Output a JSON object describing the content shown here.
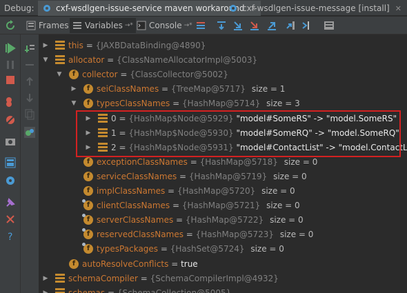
{
  "header": {
    "debug_label": "Debug:",
    "tabs": [
      {
        "label": "cxf-wsdlgen-issue-service maven workaround",
        "active": true
      },
      {
        "label": "cxf-wsdlgen-issue-message [install]",
        "active": false
      }
    ]
  },
  "toolbar": {
    "tabs": [
      {
        "label": "Frames"
      },
      {
        "label": "Variables"
      },
      {
        "label": "Console"
      }
    ]
  },
  "tree": [
    {
      "name": "this",
      "eq": " = ",
      "value": "{JAXBDataBinding@4890}",
      "extra": "",
      "sz": "",
      "indent": 0,
      "expand": "collapsed",
      "icon": "list"
    },
    {
      "name": "allocator",
      "eq": " = ",
      "value": "{ClassNameAllocatorImpl@5003}",
      "extra": "",
      "sz": "",
      "indent": 0,
      "expand": "expanded",
      "icon": "list"
    },
    {
      "name": "collector",
      "eq": " = ",
      "value": "{ClassCollector@5002}",
      "extra": "",
      "sz": "",
      "indent": 1,
      "expand": "expanded",
      "icon": "f"
    },
    {
      "name": "seiClassNames",
      "eq": " = ",
      "value": "{TreeMap@5717}",
      "extra": "",
      "sz": "size = 1",
      "indent": 2,
      "expand": "collapsed",
      "icon": "f"
    },
    {
      "name": "typesClassNames",
      "eq": " = ",
      "value": "{HashMap@5714}",
      "extra": "",
      "sz": "size = 3",
      "indent": 2,
      "expand": "expanded",
      "icon": "f"
    },
    {
      "name": "0",
      "eq": " = ",
      "value": "{HashMap$Node@5929}",
      "extra": "\"model#SomeRS\" -> \"model.SomeRS\"",
      "sz": "",
      "indent": 3,
      "expand": "collapsed",
      "icon": "entry"
    },
    {
      "name": "1",
      "eq": " = ",
      "value": "{HashMap$Node@5930}",
      "extra": "\"model#SomeRQ\" -> \"model.SomeRQ\"",
      "sz": "",
      "indent": 3,
      "expand": "collapsed",
      "icon": "entry"
    },
    {
      "name": "2",
      "eq": " = ",
      "value": "{HashMap$Node@5931}",
      "extra": "\"model#ContactList\" -> \"model.ContactList\"",
      "sz": "",
      "indent": 3,
      "expand": "collapsed",
      "icon": "entry"
    },
    {
      "name": "exceptionClassNames",
      "eq": " = ",
      "value": "{HashMap@5718}",
      "extra": "",
      "sz": "size = 0",
      "indent": 2,
      "expand": "none",
      "icon": "f"
    },
    {
      "name": "serviceClassNames",
      "eq": " = ",
      "value": "{HashMap@5719}",
      "extra": "",
      "sz": "size = 0",
      "indent": 2,
      "expand": "none",
      "icon": "f"
    },
    {
      "name": "implClassNames",
      "eq": " = ",
      "value": "{HashMap@5720}",
      "extra": "",
      "sz": "size = 0",
      "indent": 2,
      "expand": "none",
      "icon": "f"
    },
    {
      "name": "clientClassNames",
      "eq": " = ",
      "value": "{HashMap@5721}",
      "extra": "",
      "sz": "size = 0",
      "indent": 2,
      "expand": "none",
      "icon": "flock"
    },
    {
      "name": "serverClassNames",
      "eq": " = ",
      "value": "{HashMap@5722}",
      "extra": "",
      "sz": "size = 0",
      "indent": 2,
      "expand": "none",
      "icon": "flock"
    },
    {
      "name": "reservedClassNames",
      "eq": " = ",
      "value": "{HashMap@5723}",
      "extra": "",
      "sz": "size = 0",
      "indent": 2,
      "expand": "none",
      "icon": "flock"
    },
    {
      "name": "typesPackages",
      "eq": " = ",
      "value": "{HashSet@5724}",
      "extra": "",
      "sz": "size = 0",
      "indent": 2,
      "expand": "none",
      "icon": "flock"
    },
    {
      "name": "autoResolveConflicts",
      "eq": " = ",
      "value": "",
      "extra": "true",
      "sz": "",
      "indent": 1,
      "expand": "none",
      "icon": "f"
    },
    {
      "name": "schemaCompiler",
      "eq": " = ",
      "value": "{SchemaCompilerImpl@4932}",
      "extra": "",
      "sz": "",
      "indent": 0,
      "expand": "collapsed",
      "icon": "list"
    },
    {
      "name": "schemas",
      "eq": " = ",
      "value": "{SchemaCollection@5005}",
      "extra": "",
      "sz": "",
      "indent": 0,
      "expand": "collapsed",
      "icon": "list"
    }
  ]
}
